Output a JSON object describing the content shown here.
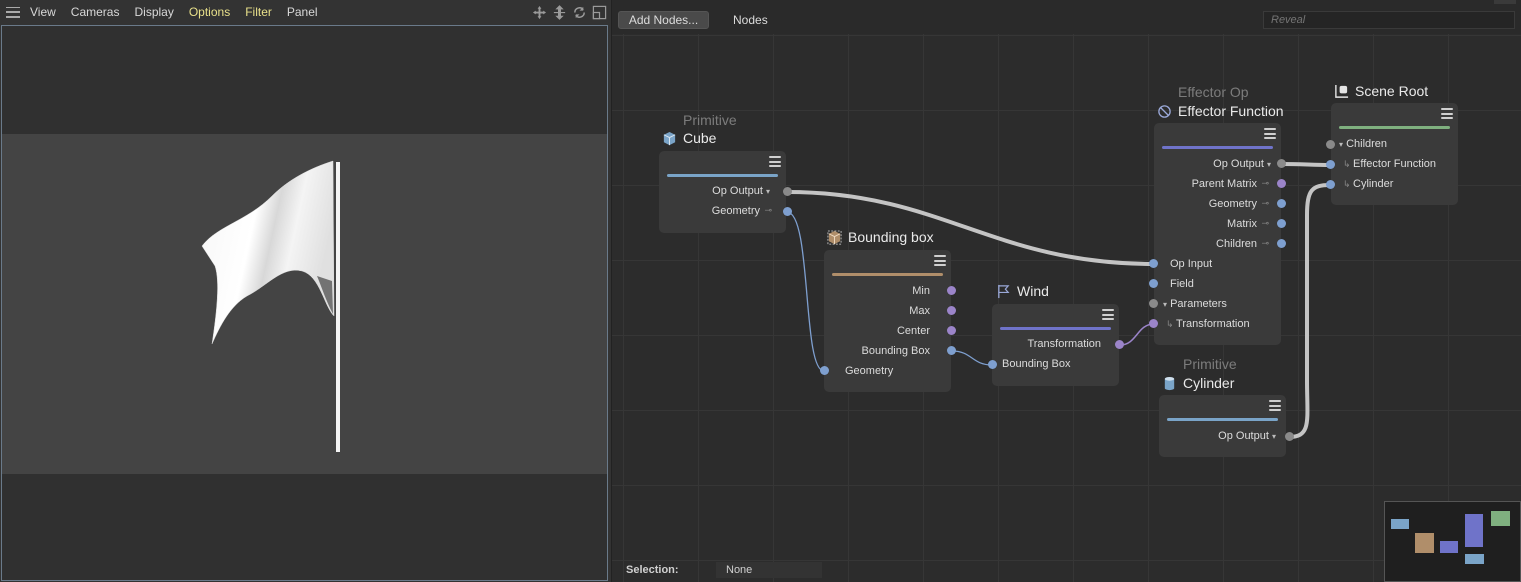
{
  "viewport": {
    "menu": [
      "View",
      "Cameras",
      "Display",
      "Options",
      "Filter",
      "Panel"
    ],
    "tool_icons": [
      "move-view-icon",
      "pan-view-icon",
      "rotate-view-icon",
      "maximize-view-icon"
    ]
  },
  "node_editor": {
    "add_nodes_label": "Add Nodes...",
    "tab_label": "Nodes",
    "reveal_placeholder": "Reveal",
    "nodes": {
      "cube": {
        "subtitle": "Primitive",
        "title": "Cube",
        "bar_color": "#7aa4c8",
        "outputs": [
          "Op Output",
          "Geometry"
        ]
      },
      "bounding_box": {
        "title": "Bounding box",
        "bar_color": "#b08e6a",
        "outputs": [
          "Min",
          "Max",
          "Center",
          "Bounding Box"
        ],
        "inputs": [
          "Geometry"
        ]
      },
      "wind": {
        "title": "Wind",
        "bar_color": "#6f73c9",
        "outputs": [
          "Transformation"
        ],
        "inputs": [
          "Bounding Box"
        ]
      },
      "effector": {
        "subtitle": "Effector Op",
        "title": "Effector Function",
        "bar_color": "#6f73c9",
        "outputs": [
          "Op Output",
          "Parent Matrix",
          "Geometry",
          "Matrix",
          "Children"
        ],
        "inputs": [
          "Op Input",
          "Field",
          "Parameters",
          "Transformation"
        ]
      },
      "scene_root": {
        "title": "Scene Root",
        "bar_color": "#7fb07f",
        "inputs": [
          "Children",
          "Effector Function",
          "Cylinder"
        ]
      },
      "cylinder": {
        "subtitle": "Primitive",
        "title": "Cylinder",
        "bar_color": "#7aa4c8",
        "outputs": [
          "Op Output"
        ]
      }
    }
  },
  "status": {
    "selection_label": "Selection:",
    "selection_value": "None"
  },
  "colors": {
    "menu_highlight": "#e8e08a",
    "port_blue": "#7e9fcf",
    "port_purple": "#9b84c9",
    "wire": "#c8c8c8"
  }
}
